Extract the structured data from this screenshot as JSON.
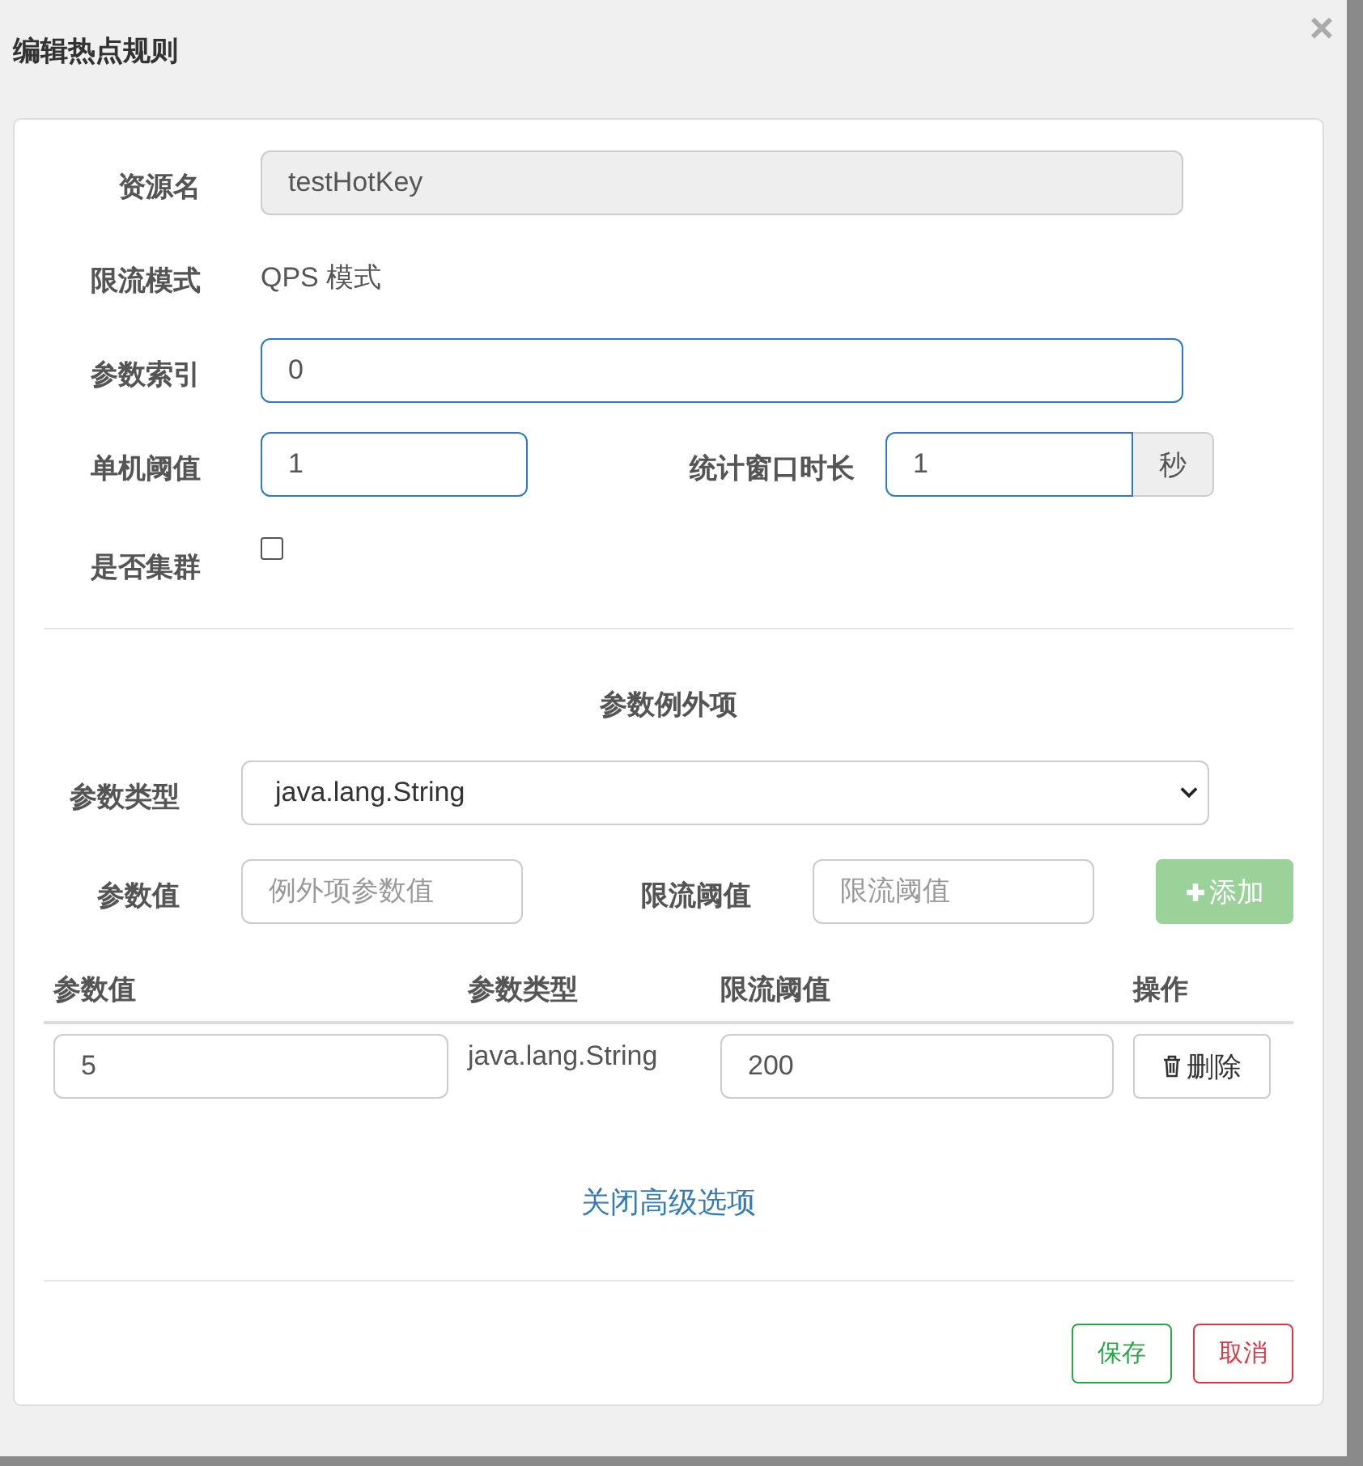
{
  "dialog": {
    "title": "编辑热点规则",
    "close": "×"
  },
  "resource": {
    "label": "资源名",
    "value": "testHotKey",
    "disabled": true
  },
  "mode": {
    "label": "限流模式",
    "value": "QPS 模式"
  },
  "param_index": {
    "label": "参数索引",
    "value": "0"
  },
  "threshold": {
    "label": "单机阈值",
    "value": "1"
  },
  "window": {
    "label": "统计窗口时长",
    "value": "1",
    "unit": "秒"
  },
  "cluster": {
    "label": "是否集群",
    "checked": false
  },
  "exceptions": {
    "title": "参数例外项",
    "type_label": "参数类型",
    "type_value": "java.lang.String",
    "value_label": "参数值",
    "value_placeholder": "例外项参数值",
    "limit_label": "限流阈值",
    "limit_placeholder": "限流阈值",
    "add_button": {
      "label": "添加",
      "disabled": true
    }
  },
  "table": {
    "columns": [
      "参数值",
      "参数类型",
      "限流阈值",
      "操作"
    ],
    "rows": [
      {
        "value": "5",
        "type": "java.lang.String",
        "limit": "200",
        "action": "删除"
      }
    ]
  },
  "toggle_link": "关闭高级选项",
  "buttons": [
    {
      "kind": "save",
      "label": "保存"
    },
    {
      "kind": "cancel",
      "label": "取消"
    }
  ]
}
